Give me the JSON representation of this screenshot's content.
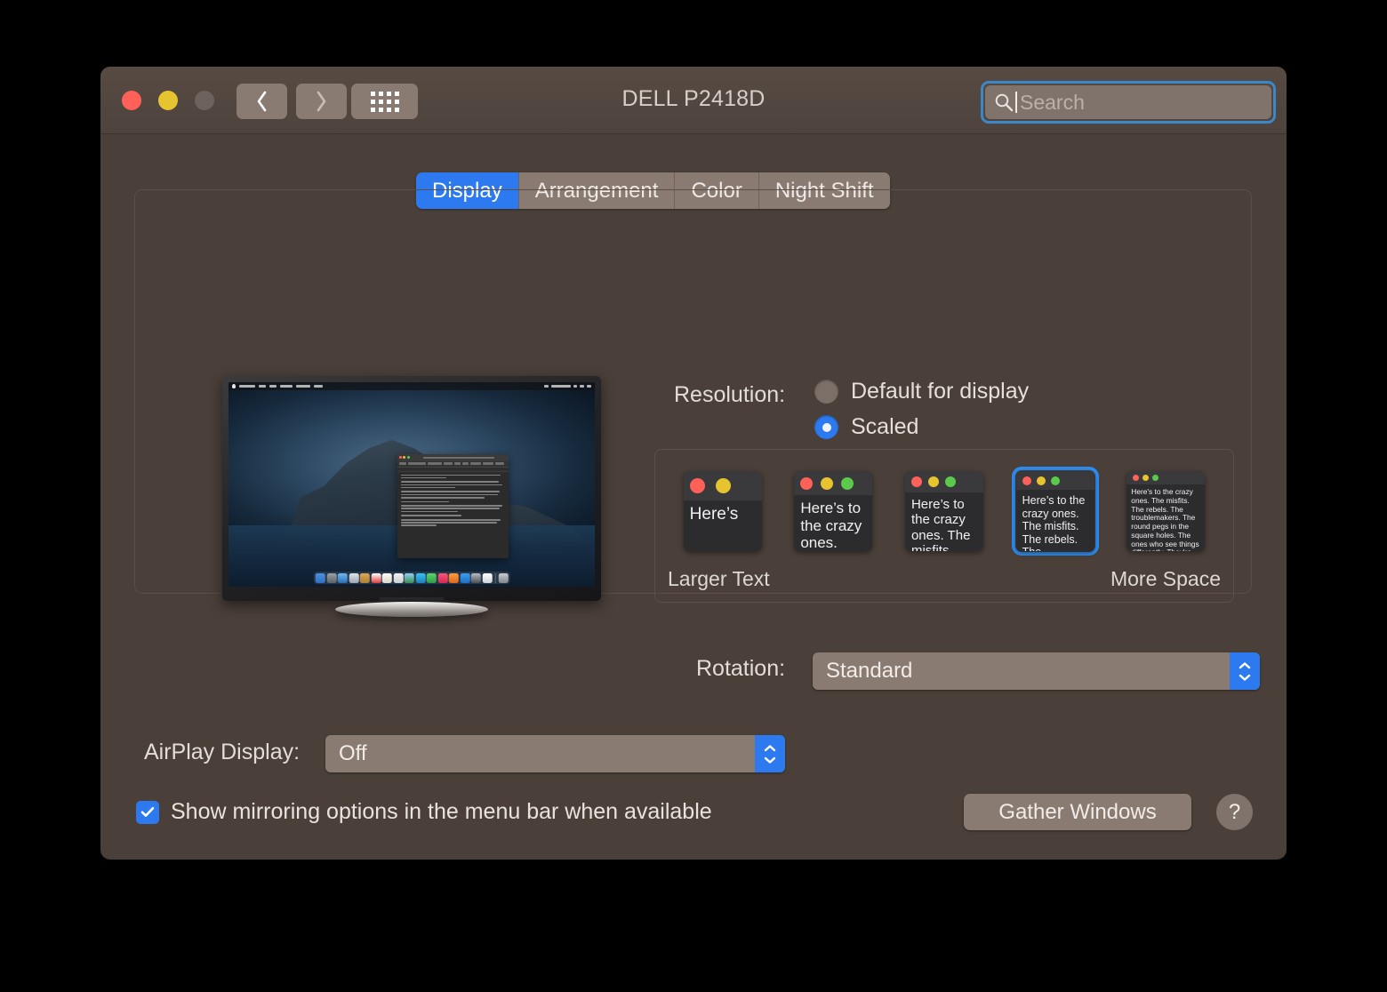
{
  "window": {
    "title": "DELL P2418D",
    "traffic_lights": [
      "close",
      "minimize",
      "zoom-disabled"
    ],
    "nav_back": "back-chevron",
    "nav_forward": "forward-chevron",
    "show_all": "grid-icon"
  },
  "search": {
    "placeholder": "Search",
    "value": "",
    "icon": "search-icon",
    "focused": true
  },
  "tabs": [
    {
      "label": "Display",
      "active": true
    },
    {
      "label": "Arrangement",
      "active": false
    },
    {
      "label": "Color",
      "active": false
    },
    {
      "label": "Night Shift",
      "active": false
    }
  ],
  "resolution": {
    "label": "Resolution:",
    "options": [
      {
        "label": "Default for display",
        "selected": false
      },
      {
        "label": "Scaled",
        "selected": true
      }
    ],
    "scaled_thumbnails": [
      {
        "index": 1,
        "text": "Here’s",
        "selected": false,
        "dots": 2
      },
      {
        "index": 2,
        "text": "Here’s to the crazy ones. The misfits.",
        "selected": false,
        "dots": 3
      },
      {
        "index": 3,
        "text": "Here’s to the crazy ones. The misfits. The rebels. The troublemakers. The round pegs in the square holes. The ones who see things differently.",
        "selected": false,
        "dots": 3
      },
      {
        "index": 4,
        "text": "Here’s to the crazy ones. The misfits. The rebels. The troublemakers. The round pegs in the square holes. The ones who see things differently. They’re not fond of rules. And they have no respect for the status quo.",
        "selected": true,
        "dots": 3
      },
      {
        "index": 5,
        "text": "Here's to the crazy ones. The misfits. The rebels. The troublemakers. The round pegs in the square holes. The ones who see things differently. They're not fond of rules. And they have no respect for the status quo. You can quote them, disagree with them, glorify or vilify them. About the only thing you can't do is ignore them. Because they change things. They push the human race forward.",
        "selected": false,
        "dots": 3
      }
    ],
    "slider_left_label": "Larger Text",
    "slider_right_label": "More Space"
  },
  "rotation": {
    "label": "Rotation:",
    "value": "Standard"
  },
  "airplay": {
    "label": "AirPlay Display:",
    "value": "Off"
  },
  "mirroring": {
    "label": "Show mirroring options in the menu bar when available",
    "checked": true
  },
  "buttons": {
    "gather_windows": "Gather Windows",
    "help": "?"
  },
  "preview": {
    "description": "display-preview-monitor",
    "wallpaper": "macos-catalina-island",
    "open_app": "TextEdit"
  },
  "colors": {
    "window_bg": "#4a3f39",
    "titlebar": "#574a43",
    "accent_blue": "#2d7af0",
    "focus_ring": "#3a88c9",
    "control_bg": "#8a7b72",
    "text_primary": "#e9e3de",
    "light_red": "#ff6159",
    "light_yellow": "#e6c42f",
    "light_gray": "#6e635c"
  }
}
